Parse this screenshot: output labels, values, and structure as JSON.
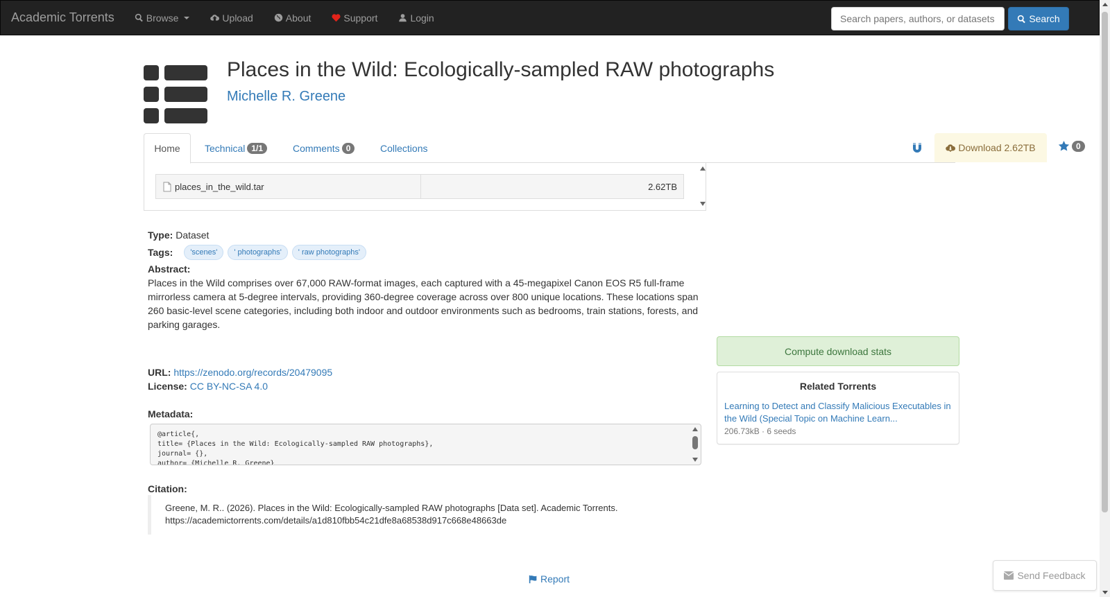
{
  "navbar": {
    "brand": "Academic Torrents",
    "items": [
      {
        "label": "Browse",
        "icon": "search-icon"
      },
      {
        "label": "Upload",
        "icon": "cloud-upload-icon"
      },
      {
        "label": "About",
        "icon": "globe-icon"
      },
      {
        "label": "Support",
        "icon": "heart-icon"
      },
      {
        "label": "Login",
        "icon": "user-icon"
      }
    ],
    "search_placeholder": "Search papers, authors, or datasets",
    "search_button": "Search"
  },
  "header": {
    "title": "Places in the Wild: Ecologically-sampled RAW photographs",
    "author": "Michelle R. Greene"
  },
  "tabs": {
    "home": "Home",
    "technical": "Technical",
    "technical_badge": "1/1",
    "comments": "Comments",
    "comments_badge": "0",
    "collections": "Collections",
    "download": "Download 2.62TB",
    "star_count": "0"
  },
  "files": [
    {
      "name": "places_in_the_wild.tar",
      "size": "2.62TB"
    }
  ],
  "details": {
    "type_label": "Type:",
    "type_value": "Dataset",
    "tags_label": "Tags:",
    "tags": [
      "'scenes'",
      "' photographs'",
      "' raw photographs'"
    ],
    "abstract_label": "Abstract:",
    "abstract": "Places in the Wild comprises over 67,000 RAW-format images, each captured with a 45-megapixel Canon EOS R5 full-frame mirrorless camera at 5-degree intervals, providing 360-degree coverage across over 800 unique locations. These locations span 260 basic-level scene categories, including both indoor and outdoor environments such as bedrooms, train stations, forests, and parking garages.",
    "url_label": "URL:",
    "url": "https://zenodo.org/records/20479095",
    "license_label": "License:",
    "license": "CC BY-NC-SA 4.0",
    "metadata_label": "Metadata:",
    "metadata": "@article{,\ntitle= {Places in the Wild: Ecologically-sampled RAW photographs},\njournal= {},\nauthor= {Michelle R. Greene}",
    "citation_label": "Citation:",
    "citation": "Greene, M. R.. (2026). Places in the Wild: Ecologically-sampled RAW photographs [Data set]. Academic Torrents. https://academictorrents.com/details/a1d810fbb54c21dfe8a68538d917c668e48663de",
    "report": "Report"
  },
  "sidebar": {
    "stats_button": "Compute download stats",
    "related_title": "Related Torrents",
    "related": [
      {
        "title": "Learning to Detect and Classify Malicious Executables in the Wild (Special Topic on Machine Learn...",
        "meta": "206.73kB · 6 seeds"
      }
    ]
  },
  "feedback": "Send Feedback"
}
